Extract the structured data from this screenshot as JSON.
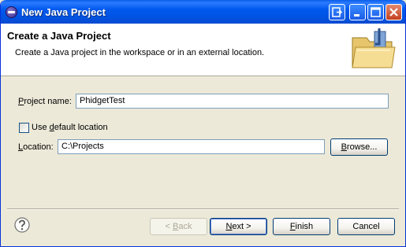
{
  "window": {
    "title": "New Java Project"
  },
  "header": {
    "title": "Create a Java Project",
    "description": "Create a Java project in the workspace or in an external location."
  },
  "form": {
    "project_name_label_pre": "P",
    "project_name_label_post": "roject name:",
    "project_name_value": "PhidgetTest",
    "use_default_pre": "Use ",
    "use_default_mid": "d",
    "use_default_post": "efault location",
    "use_default_checked": false,
    "location_label_pre": "L",
    "location_label_post": "ocation:",
    "location_value": "C:\\Projects",
    "browse_pre": "B",
    "browse_post": "rowse..."
  },
  "footer": {
    "back_pre": "< ",
    "back_mid": "B",
    "back_post": "ack",
    "next_mid": "N",
    "next_post": "ext >",
    "finish_mid": "F",
    "finish_post": "inish",
    "cancel_label": "Cancel"
  },
  "colors": {
    "titlebar": "#0054e3",
    "dialog_bg": "#ece9d8",
    "field_border": "#7f9db9"
  },
  "icons": {
    "title": "eclipse-icon",
    "header": "java-project-folder-icon",
    "help": "help-icon"
  }
}
